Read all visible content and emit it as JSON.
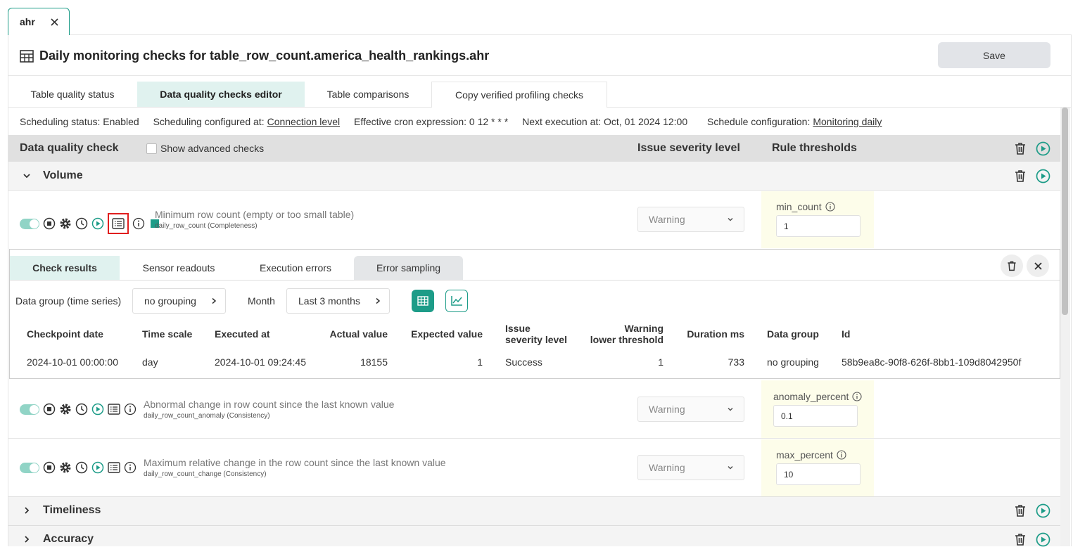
{
  "file_tab": {
    "label": "ahr"
  },
  "header": {
    "title": "Daily monitoring checks for table_row_count.america_health_rankings.ahr",
    "save_label": "Save"
  },
  "main_tabs": [
    {
      "label": "Table quality status"
    },
    {
      "label": "Data quality checks editor"
    },
    {
      "label": "Table comparisons"
    },
    {
      "label": "Copy verified profiling checks"
    }
  ],
  "schedule": {
    "status": "Scheduling status: Enabled",
    "configured_prefix": "Scheduling configured at:",
    "configured_link": "Connection level",
    "cron": "Effective cron expression: 0 12 * * *",
    "next": "Next execution at: Oct, 01 2024 12:00",
    "config_prefix": "Schedule configuration:",
    "config_link": "Monitoring daily"
  },
  "grid_header": {
    "check_label": "Data quality check",
    "advanced_label": "Show advanced checks",
    "severity_label": "Issue severity level",
    "thresholds_label": "Rule thresholds"
  },
  "sections": {
    "volume": "Volume",
    "timeliness": "Timeliness",
    "accuracy": "Accuracy"
  },
  "checks": [
    {
      "name": "Minimum row count (empty or too small table)",
      "sub": "daily_row_count (Completeness)",
      "severity": "Warning",
      "param": "min_count",
      "value": "1"
    },
    {
      "name": "Abnormal change in row count since the last known value",
      "sub": "daily_row_count_anomaly (Consistency)",
      "severity": "Warning",
      "param": "anomaly_percent",
      "value": "0.1"
    },
    {
      "name": "Maximum relative change in the row count since the last known value",
      "sub": "daily_row_count_change (Consistency)",
      "severity": "Warning",
      "param": "max_percent",
      "value": "10"
    }
  ],
  "results": {
    "tabs": [
      "Check results",
      "Sensor readouts",
      "Execution errors",
      "Error sampling"
    ],
    "data_group_label": "Data group (time series)",
    "data_group_value": "no grouping",
    "month_label": "Month",
    "month_value": "Last 3 months",
    "columns": [
      "Checkpoint date",
      "Time scale",
      "Executed at",
      "Actual value",
      "Expected value",
      "Issue",
      "severity level",
      "Warning",
      "lower threshold",
      "Duration ms",
      "Data group",
      "Id"
    ],
    "row": {
      "checkpoint": "2024-10-01 00:00:00",
      "time_scale": "day",
      "executed_at": "2024-10-01 09:24:45",
      "actual": "18155",
      "expected": "1",
      "severity": "Success",
      "warning": "1",
      "duration": "733",
      "group": "no grouping",
      "id": "58b9ea8c-90f8-626f-8bb1-109d8042950f"
    }
  },
  "colors": {
    "accent": "#1d9c88",
    "highlight": "#e01e1e",
    "toggle": "#91d4c6"
  }
}
